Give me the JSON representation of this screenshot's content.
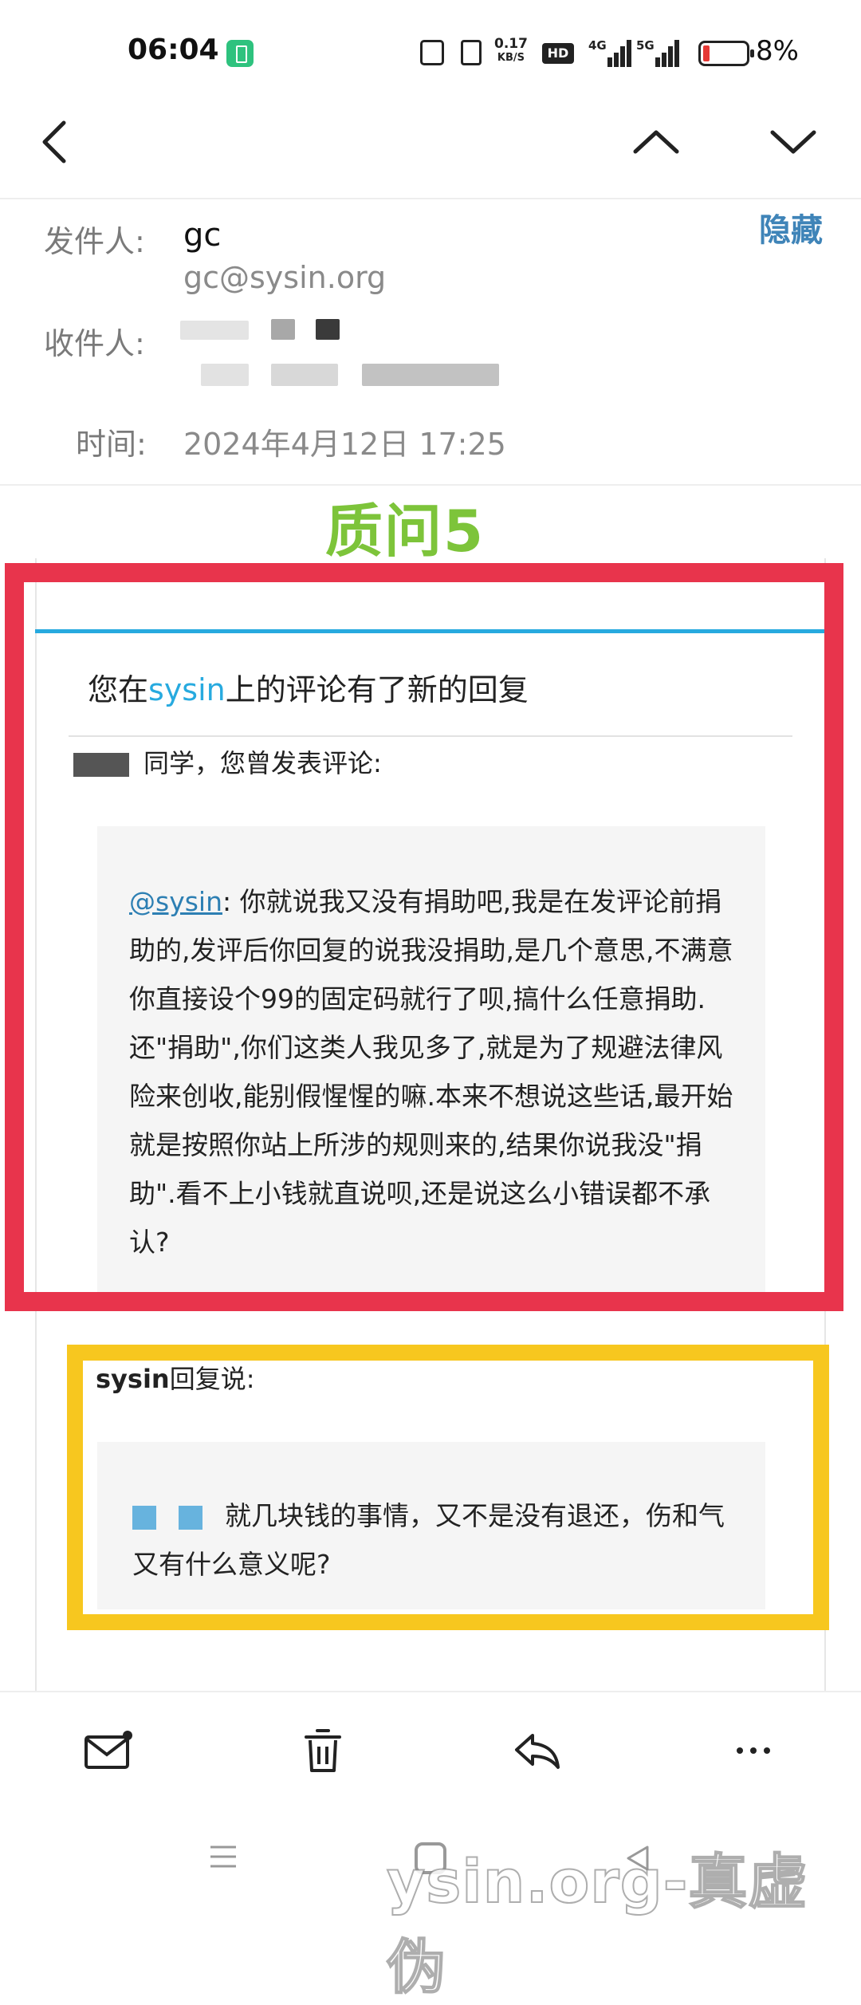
{
  "status_bar": {
    "time": "06:04",
    "net_speed_value": "0.17",
    "net_speed_unit": "KB/S",
    "hd_label": "HD",
    "signal_1_label": "4G",
    "signal_2_label": "5G",
    "battery_percent": "8%",
    "icons": [
      "battery-saver-icon",
      "nfc-icon",
      "vibrate-icon",
      "hd-icon",
      "signal-4g-icon",
      "signal-5g-icon",
      "battery-icon"
    ]
  },
  "nav": {
    "icons": [
      "back-icon",
      "chevron-up-icon",
      "chevron-down-icon"
    ]
  },
  "header": {
    "sender_label": "发件人:",
    "sender_name": "gc",
    "sender_email": "gc@sysin.org",
    "hide_label": "隐藏",
    "recipient_label": "收件人:",
    "time_label": "时间:",
    "time_value": "2024年4月12日 17:25"
  },
  "overlay": {
    "caption": "质问5",
    "watermark": "ysin.org-真虚伪",
    "frame_colors": {
      "red": "#e8344c",
      "yellow": "#f7c71f"
    }
  },
  "mail": {
    "title_prefix": "您在",
    "title_site": "sysin",
    "title_suffix": "上的评论有了新的回复",
    "greeting": "同学，您曾发表评论:",
    "comment_mention": "@sysin",
    "comment_body": ": 你就说我又没有捐助吧,我是在发评论前捐助的,发评后你回复的说我没捐助,是几个意思,不满意你直接设个99的固定码就行了呗,搞什么任意捐助.还\"捐助\",你们这类人我见多了,就是为了规避法律风险来创收,能别假惺惺的嘛.本来不想说这些话,最开始就是按照你站上所涉的规则来的,结果你说我没\"捐助\".看不上小钱就直说呗,还是说这么小错误都不承认?",
    "reply_author": "sysin",
    "reply_verb": "回复说:",
    "reply_body": "就几块钱的事情，又不是没有退还，伤和气又有什么意义呢?",
    "accent_color": "#27aadf"
  },
  "toolbar": {
    "icons": [
      "mail-unread-icon",
      "trash-icon",
      "reply-icon",
      "more-icon"
    ]
  }
}
